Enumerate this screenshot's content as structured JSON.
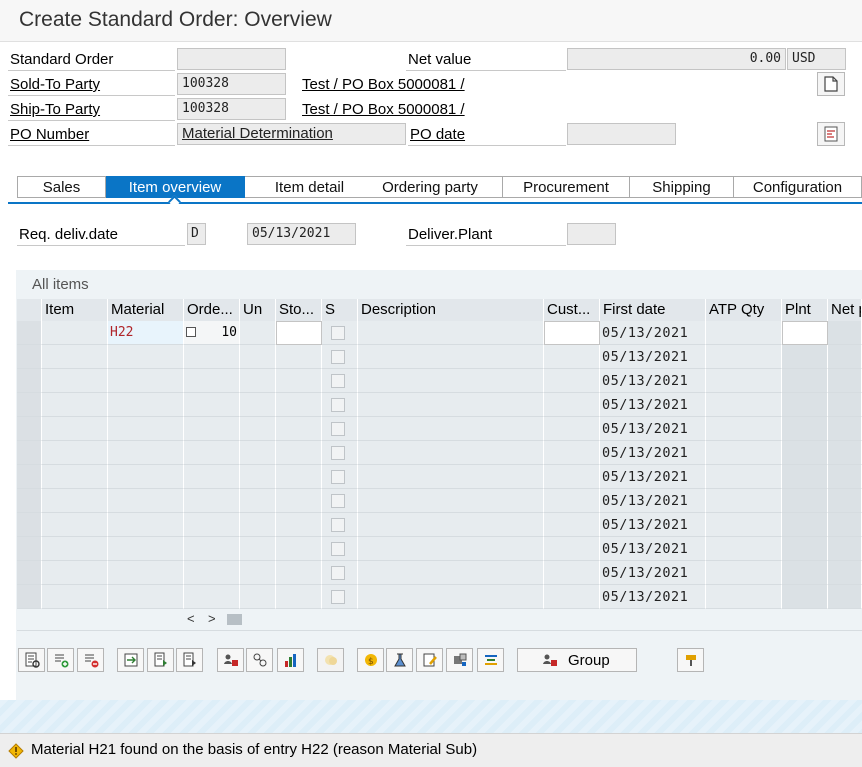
{
  "title": "Create Standard Order: Overview",
  "header": {
    "standard_order_label": "Standard Order",
    "standard_order_value": "",
    "net_value_label": "Net value",
    "net_value": "0.00",
    "currency": "USD",
    "sold_to_label": "Sold-To Party",
    "sold_to_value": "100328",
    "sold_to_name": "Test / PO Box 5000081 /",
    "ship_to_label": "Ship-To Party",
    "ship_to_value": "100328",
    "ship_to_name": "Test / PO Box 5000081 /",
    "po_number_label": "PO Number",
    "po_number_value": "Material Determination",
    "po_date_label": "PO date",
    "po_date_value": ""
  },
  "tabs": [
    "Sales",
    "Item overview",
    "Item detail",
    "Ordering party",
    "Procurement",
    "Shipping",
    "Configuration"
  ],
  "active_tab": "Item overview",
  "delivery": {
    "req_deliv_label": "Req. deliv.date",
    "req_deliv_type": "D",
    "req_deliv_date": "05/13/2021",
    "deliver_plant_label": "Deliver.Plant",
    "deliver_plant_value": ""
  },
  "table": {
    "title": "All items",
    "columns": [
      "Item",
      "Material",
      "Orde...",
      "Un",
      "Sto...",
      "S",
      "Description",
      "Cust...",
      "First date",
      "ATP Qty",
      "Plnt",
      "Net p"
    ],
    "rows": [
      {
        "item": "",
        "material": "H22",
        "qty": "10",
        "first_date": "05/13/2021"
      },
      {
        "item": "",
        "material": "",
        "qty": "",
        "first_date": "05/13/2021"
      },
      {
        "item": "",
        "material": "",
        "qty": "",
        "first_date": "05/13/2021"
      },
      {
        "item": "",
        "material": "",
        "qty": "",
        "first_date": "05/13/2021"
      },
      {
        "item": "",
        "material": "",
        "qty": "",
        "first_date": "05/13/2021"
      },
      {
        "item": "",
        "material": "",
        "qty": "",
        "first_date": "05/13/2021"
      },
      {
        "item": "",
        "material": "",
        "qty": "",
        "first_date": "05/13/2021"
      },
      {
        "item": "",
        "material": "",
        "qty": "",
        "first_date": "05/13/2021"
      },
      {
        "item": "",
        "material": "",
        "qty": "",
        "first_date": "05/13/2021"
      },
      {
        "item": "",
        "material": "",
        "qty": "",
        "first_date": "05/13/2021"
      },
      {
        "item": "",
        "material": "",
        "qty": "",
        "first_date": "05/13/2021"
      },
      {
        "item": "",
        "material": "",
        "qty": "",
        "first_date": "05/13/2021"
      }
    ]
  },
  "toolbar": {
    "group_label": "Group"
  },
  "status": {
    "message": "Material H21 found on the basis of entry H22 (reason Material Sub)"
  },
  "colors": {
    "accent": "#0a75c6",
    "material_text": "#b0252a",
    "warning": "#e0a000"
  }
}
